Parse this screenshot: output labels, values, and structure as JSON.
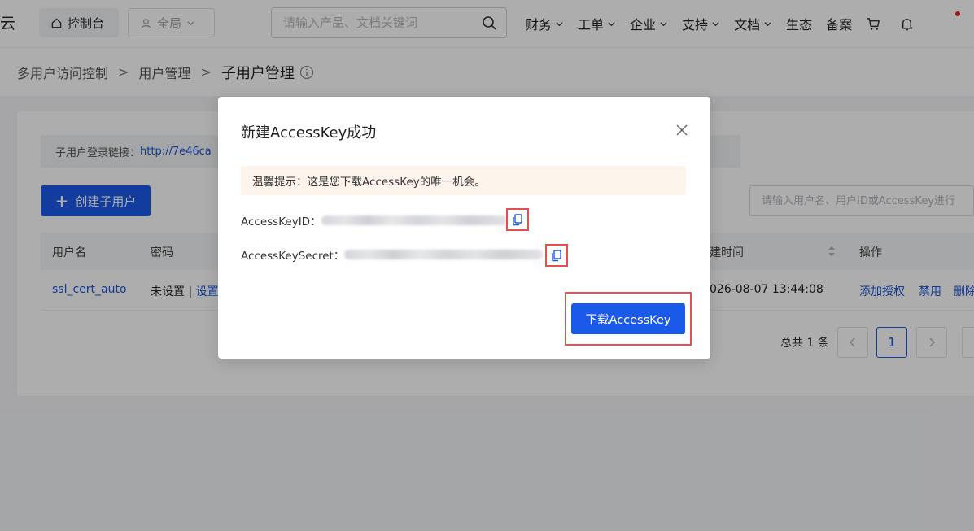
{
  "topbar": {
    "brand_fragment": "云",
    "console_label": "控制台",
    "region_label": "全局",
    "search_placeholder": "请输入产品、文档关键词",
    "menu": [
      {
        "label": "财务"
      },
      {
        "label": "工单"
      },
      {
        "label": "企业"
      },
      {
        "label": "支持"
      },
      {
        "label": "文档"
      }
    ],
    "plain_links": [
      "生态",
      "备案"
    ]
  },
  "breadcrumb": {
    "items": [
      "多用户访问控制",
      "用户管理"
    ],
    "current": "子用户管理"
  },
  "page": {
    "login_link_label": "子用户登录链接：",
    "login_link_url": "http://7e46ca",
    "create_button": "创建子用户",
    "filter_placeholder": "请输入用户名、用户ID或AccessKey进行",
    "table": {
      "headers": [
        "用户名",
        "密码",
        "建时间",
        "操作"
      ],
      "row": {
        "username": "ssl_cert_auto",
        "password_status": "未设置 | ",
        "password_action": "设置",
        "created": "026-08-07 13:44:08",
        "actions": [
          "添加授权",
          "禁用",
          "删除"
        ]
      }
    },
    "pagination": {
      "total_text": "总共 1 条",
      "current_page": "1"
    }
  },
  "modal": {
    "title": "新建AccessKey成功",
    "notice": "温馨提示：这是您下载AccessKey的唯一机会。",
    "key_id_label": "AccessKeyID：",
    "key_secret_label": "AccessKeySecret：",
    "download_button": "下载AccessKey"
  },
  "colors": {
    "primary": "#1b59e8",
    "highlight_box": "#e05252",
    "notice_bg": "#fdf4ec"
  }
}
